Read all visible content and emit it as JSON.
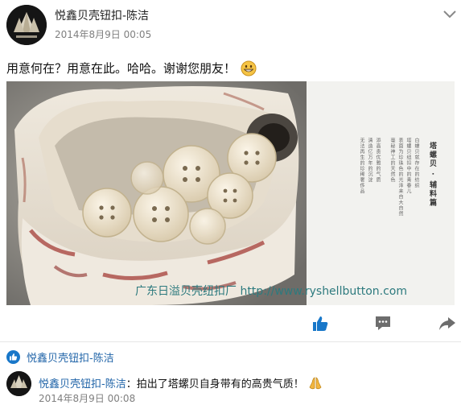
{
  "post": {
    "author": "悦鑫贝壳钮扣-陈洁",
    "timestamp": "2014年8月9日 00:05",
    "text": "用意何在？用意在此。哈哈。谢谢您朋友！",
    "emoji": "grinning-face-icon",
    "options_icon": "chevron-down-icon"
  },
  "image": {
    "panel_title": "塔螺贝 · 辅料篇",
    "panel_lines": [
      "白蝶贝就存在的纺织",
      "塔螺贝纽扣中的青春儿",
      "表面为珍珠色的光泽来自大自然",
      "毫秘神工的天然色",
      "添高贵优雅的气质",
      "清造亿万年的沉淀",
      "无法再生的珍稀奢侈品"
    ],
    "watermark": "广东日溢贝壳纽扣厂 http://www.ryshellbutton.com"
  },
  "actions": {
    "like_icon": "thumbs-up-icon",
    "comment_icon": "comment-icon",
    "share_icon": "share-icon"
  },
  "likes": {
    "icon": "like-badge-icon",
    "names": "悦鑫贝壳钮扣-陈洁"
  },
  "comment": {
    "author": "悦鑫贝壳钮扣-陈洁",
    "text": "：拍出了塔螺贝自身带有的高贵气质！",
    "emoji": "praying-hands-icon",
    "timestamp": "2014年8月9日 00:08"
  },
  "colors": {
    "link": "#2064a8",
    "accent": "#1877c9",
    "watermark": "#2d7a7e"
  }
}
